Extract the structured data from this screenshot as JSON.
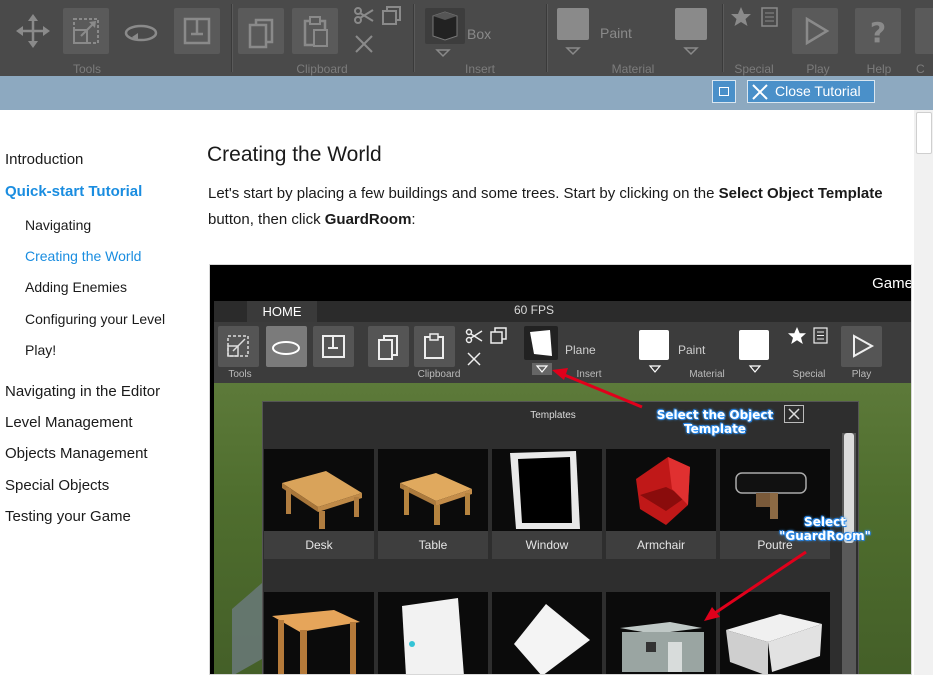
{
  "toolbar": {
    "groups": [
      {
        "label": "Tools"
      },
      {
        "label": "Clipboard"
      },
      {
        "label": "Insert",
        "selected_object": "Box"
      },
      {
        "label": "Material",
        "paint_label": "Paint"
      },
      {
        "label": "Special"
      },
      {
        "label": "Play"
      },
      {
        "label": "Help"
      },
      {
        "label": "C"
      }
    ]
  },
  "tutorial_bar": {
    "close_label": "Close Tutorial"
  },
  "sidebar": {
    "items": [
      {
        "label": "Introduction"
      },
      {
        "label": "Quick-start Tutorial"
      },
      {
        "label": "Navigating"
      },
      {
        "label": "Creating the World"
      },
      {
        "label": "Adding Enemies"
      },
      {
        "label": "Configuring your Level"
      },
      {
        "label": "Play!"
      },
      {
        "label": "Navigating in the Editor"
      },
      {
        "label": "Level Management"
      },
      {
        "label": "Objects Management"
      },
      {
        "label": "Special Objects"
      },
      {
        "label": "Testing your Game"
      }
    ]
  },
  "content": {
    "title": "Creating the World",
    "para": {
      "t1": "Let's start by placing a few buildings and some trees. Start by clicking on the ",
      "b1": "Select Object Template",
      "t2": " button, then click ",
      "b2": "GuardRoom",
      "t3": ":"
    }
  },
  "screenshot": {
    "window_title": "Game",
    "tab": "HOME",
    "fps": "60 FPS",
    "labels": {
      "tools": "Tools",
      "clipboard": "Clipboard",
      "insert": "Insert",
      "material": "Material",
      "special": "Special",
      "play": "Play",
      "plane": "Plane",
      "paint": "Paint"
    },
    "templates_title": "Templates",
    "templates": [
      {
        "name": "Desk"
      },
      {
        "name": "Table"
      },
      {
        "name": "Window"
      },
      {
        "name": "Armchair"
      },
      {
        "name": "Poutre"
      }
    ],
    "annotations": {
      "select_template": "Select the Object Template",
      "select_guardroom": "Select \"GuardRoom\""
    },
    "colors": {
      "annotation_arrow": "#e0001b",
      "annotation_text_glow": "#3aa0ff"
    }
  },
  "colors": {
    "toolbar_bg": "#4a4a4a",
    "tutorial_bar_bg": "#8da9c0",
    "button_blue": "#4a90c9",
    "link_active": "#1a8de0"
  }
}
